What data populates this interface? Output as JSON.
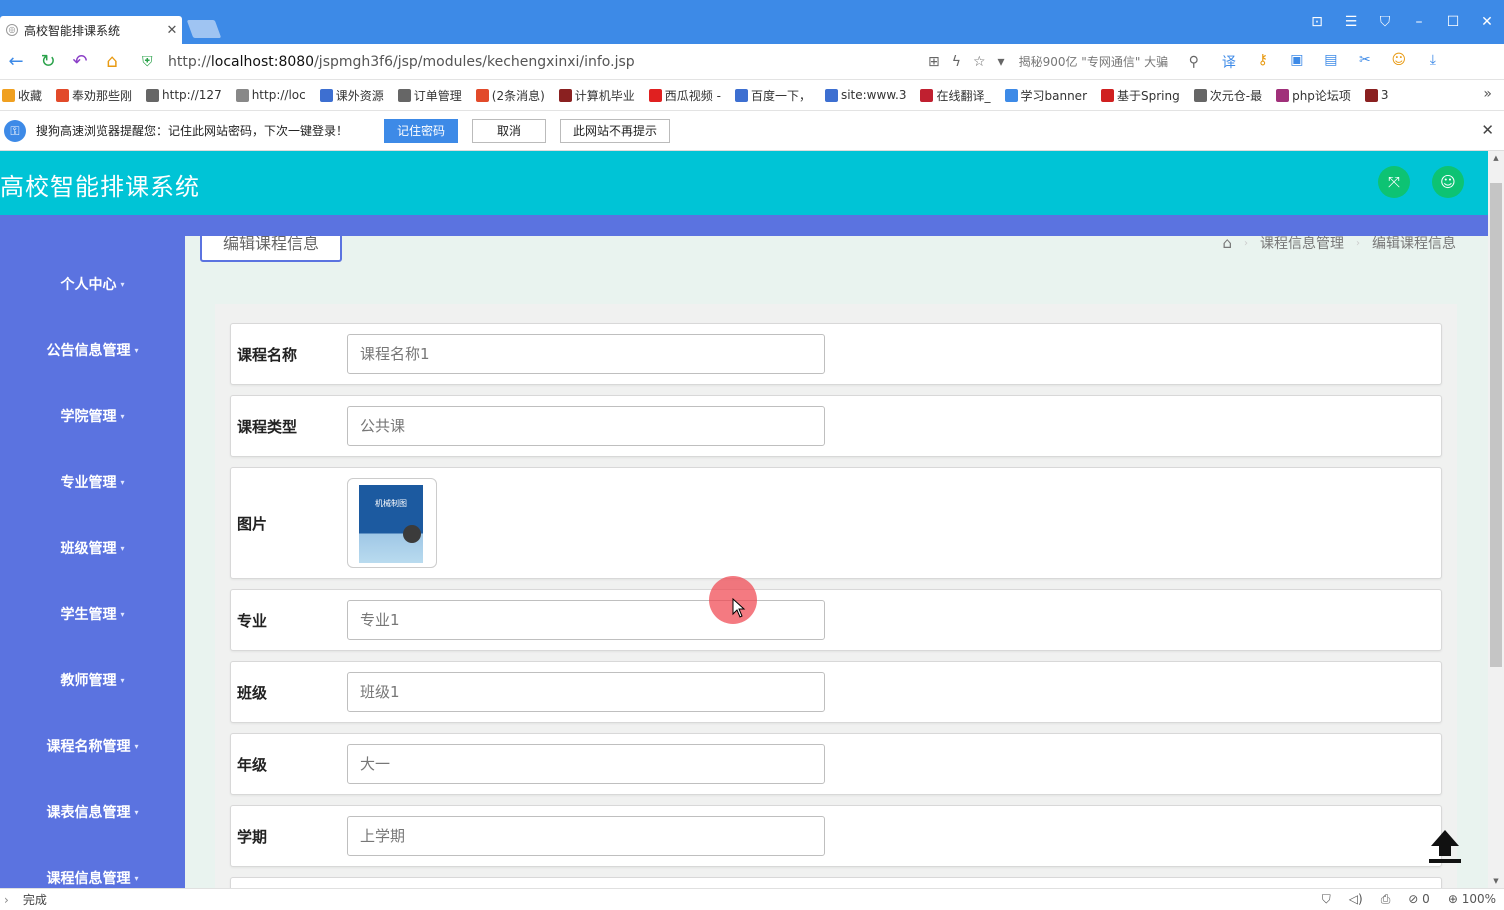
{
  "browser": {
    "tab_title": "高校智能排课系统",
    "url_prefix": "http://",
    "url_host": "localhost:8080",
    "url_path": "/jspmgh3f6/jsp/modules/kechengxinxi/info.jsp",
    "search_hint": "揭秘900亿 \"专网通信\" 大骗",
    "bookmarks": [
      "收藏",
      "奉劝那些刚",
      "http://127",
      "http://loc",
      "课外资源",
      "订单管理",
      "(2条消息)",
      "计算机毕业",
      "西瓜视频 -",
      "百度一下，",
      "site:www.3",
      "在线翻译_",
      "学习banner",
      "基于Spring",
      "次元仓-最",
      "php论坛项",
      "3"
    ],
    "pwd_message": "搜狗高速浏览器提醒您：记住此网站密码，下次一键登录！",
    "pwd_remember": "记住密码",
    "pwd_cancel": "取消",
    "pwd_never": "此网站不再提示",
    "status_text": "完成",
    "zoom": "100%",
    "status_count": "0"
  },
  "app": {
    "title": "高校智能排课系统",
    "sidebar": [
      "个人中心",
      "公告信息管理",
      "学院管理",
      "专业管理",
      "班级管理",
      "学生管理",
      "教师管理",
      "课程名称管理",
      "课表信息管理",
      "课程信息管理"
    ],
    "page_chip": "编辑课程信息",
    "breadcrumb": [
      "课程信息管理",
      "编辑课程信息"
    ],
    "book_cover_text": "机械制图"
  },
  "form": {
    "rows": [
      {
        "label": "课程名称",
        "value": "课程名称1"
      },
      {
        "label": "课程类型",
        "value": "公共课"
      },
      {
        "label": "图片",
        "value": ""
      },
      {
        "label": "专业",
        "value": "专业1"
      },
      {
        "label": "班级",
        "value": "班级1"
      },
      {
        "label": "年级",
        "value": "大一"
      },
      {
        "label": "学期",
        "value": "上学期"
      }
    ]
  },
  "colors": {
    "header": "#00c4d6",
    "sidebar": "#5b73e0",
    "browser_blue": "#3d8ae7",
    "header_button": "#0dc373"
  }
}
